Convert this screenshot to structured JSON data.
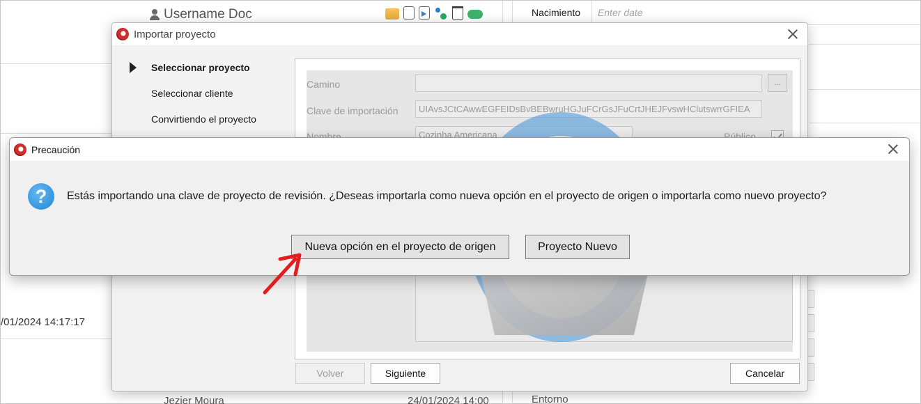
{
  "background": {
    "username": "Username Doc",
    "birth_label": "Nacimiento",
    "birth_placeholder": "Enter date",
    "date_text": "/01/2024 14:17:17",
    "bottom_left_text": "Jezier Moura",
    "bottom_mid_text": "24/01/2024 14:00",
    "bottom_right_label": "Entorno",
    "toolbar_icons": [
      "open-folder-icon",
      "copy-icon",
      "move-icon",
      "tree-icon",
      "trash-icon",
      "cloud-icon"
    ]
  },
  "import_dialog": {
    "title": "Importar proyecto",
    "steps": [
      {
        "label": "Seleccionar proyecto",
        "active": true
      },
      {
        "label": "Seleccionar cliente",
        "active": false
      },
      {
        "label": "Convirtiendo el proyecto",
        "active": false
      }
    ],
    "fields": {
      "path_label": "Camino",
      "path_value": "",
      "browse_label": "...",
      "key_label": "Clave de importación",
      "key_value": "UIAvsJCtCAwwEGFEIDsBvBEBwruHGJuFCrGsJFuCrtJHEJFvswHClutswrrGFIEA",
      "name_label": "Nombre",
      "name_value": "Cozinha Americana",
      "public_label": "Público",
      "public_checked": true
    },
    "buttons": {
      "back": "Volver",
      "next": "Siguiente",
      "cancel": "Cancelar"
    }
  },
  "caution_dialog": {
    "title": "Precaución",
    "message": "Estás importando una clave de proyecto de revisión. ¿Deseas importarla como nueva opción en el proyecto de origen o importarla como nuevo proyecto?",
    "buttons": {
      "new_option": "Nueva opción en el proyecto de origen",
      "new_project": "Proyecto Nuevo"
    }
  },
  "colors": {
    "accent_blue": "#1f88d8",
    "annotation_red": "#e31c1c",
    "logo_red": "#d12d2d"
  }
}
